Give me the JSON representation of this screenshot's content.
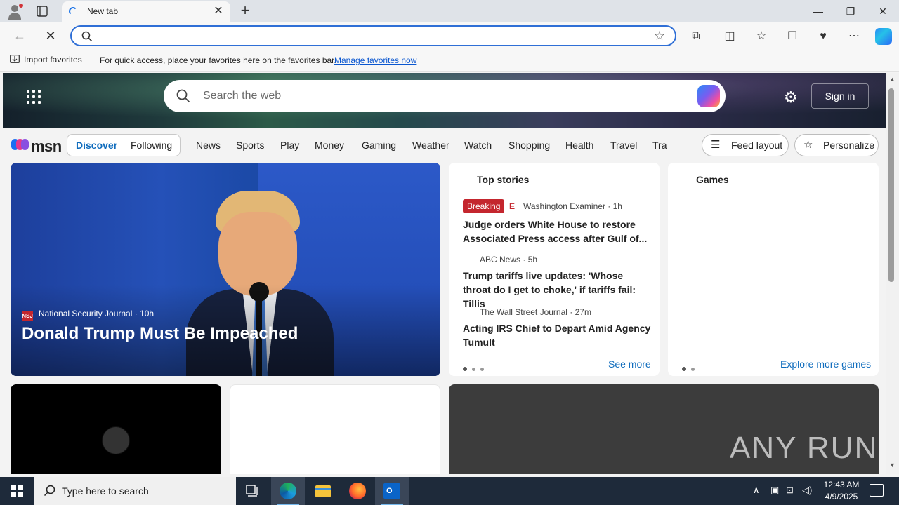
{
  "browser": {
    "tab_title": "New tab",
    "address_value": "",
    "favbar": {
      "import_label": "Import favorites",
      "message": "For quick access, place your favorites here on the favorites bar.",
      "link": "Manage favorites now"
    }
  },
  "msn": {
    "search_placeholder": "Search the web",
    "signin_label": "Sign in",
    "logo_text": "msn",
    "feed_tabs": {
      "discover": "Discover",
      "following": "Following"
    },
    "nav_links": [
      "News",
      "Sports",
      "Play",
      "Money",
      "Gaming",
      "Weather",
      "Watch",
      "Shopping",
      "Health",
      "Travel",
      "Tra"
    ],
    "feed_layout_label": "Feed layout",
    "personalize_label": "Personalize",
    "main_story": {
      "source_logo": "NSJ",
      "source": "National Security Journal",
      "age": "10h",
      "headline": "Donald Trump Must Be Impeached"
    },
    "top_stories": {
      "title": "Top stories",
      "badge": "Breaking",
      "items": [
        {
          "source": "Washington Examiner",
          "age": "1h",
          "headline": "Judge orders White House to restore Associated Press access after Gulf of..."
        },
        {
          "source": "ABC News",
          "age": "5h",
          "headline": "Trump tariffs live updates: 'Whose throat do I get to choke,' if tariffs fail: Tillis"
        },
        {
          "source": "The Wall Street Journal",
          "age": "27m",
          "headline": "Acting IRS Chief to Depart Amid Agency Tumult"
        }
      ],
      "see_more": "See more"
    },
    "games": {
      "title": "Games",
      "explore": "Explore more games"
    },
    "watermark": "ANY RUN"
  },
  "taskbar": {
    "search_placeholder": "Type here to search",
    "time": "12:43 AM",
    "date": "4/9/2025"
  },
  "colors": {
    "accent": "#0f6cbd",
    "breaking": "#c4262e",
    "address_border": "#2f6fd6",
    "taskbar": "#1e2a3a"
  }
}
